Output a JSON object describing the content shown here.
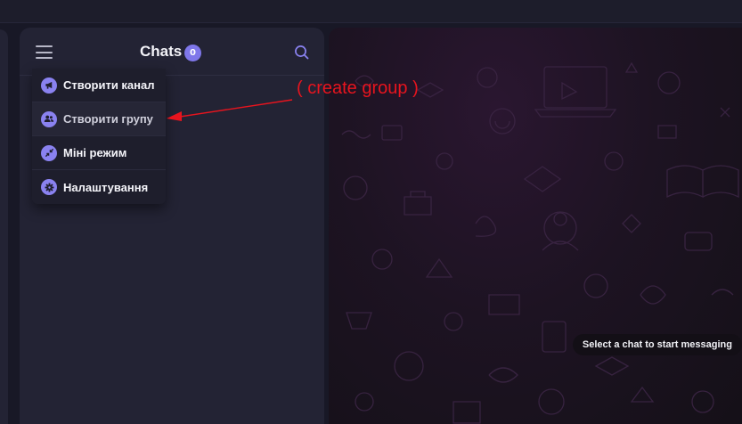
{
  "chats_header": {
    "title": "Chats",
    "unread_count": "0",
    "menu_icon": "hamburger-icon",
    "search_icon": "search-icon"
  },
  "dropdown_menu": {
    "items": [
      {
        "label": "Створити канал",
        "icon": "megaphone-icon"
      },
      {
        "label": "Створити групу",
        "icon": "group-icon"
      },
      {
        "label": "Міні режим",
        "icon": "minimize-arrows-icon"
      },
      {
        "label": "Налаштування",
        "icon": "gear-icon"
      }
    ]
  },
  "conversation": {
    "empty_state": "Select a chat to start messaging"
  },
  "annotation": {
    "text": "( create group )",
    "color": "#e8141e"
  },
  "colors": {
    "accent": "#7f77ea",
    "panel": "#232334",
    "background": "#181826"
  }
}
